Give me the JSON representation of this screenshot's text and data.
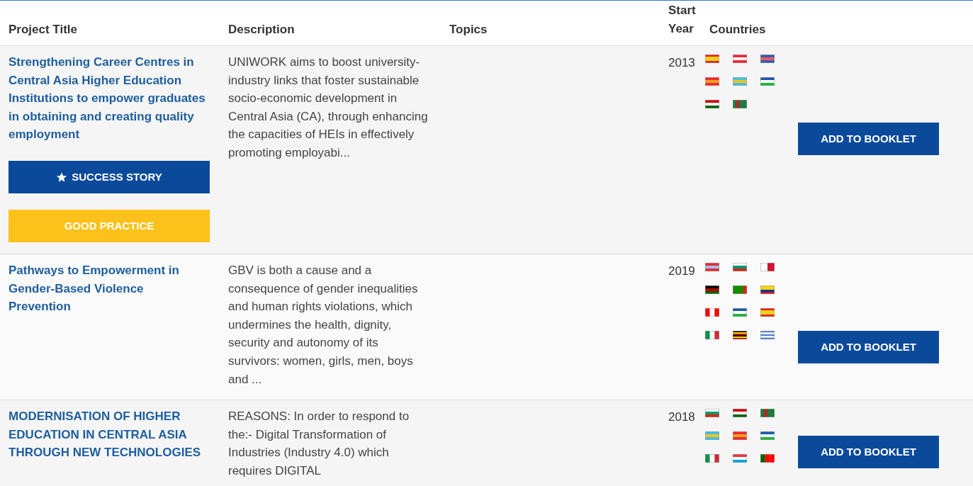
{
  "table": {
    "columns": [
      {
        "label": "Project Title"
      },
      {
        "label": "Description"
      },
      {
        "label": "Topics"
      },
      {
        "label": "Start Year"
      },
      {
        "label": "Countries"
      }
    ],
    "rows": [
      {
        "title": "Strengthening Career Centres in Central Asia Higher Education Institutions to empower graduates in obtaining and creating quality employment",
        "badges": [
          {
            "kind": "success",
            "label": "SUCCESS STORY"
          },
          {
            "kind": "practice",
            "label": "GOOD PRACTICE"
          }
        ],
        "description": "UNIWORK aims to boost university-industry links that foster sustainable socio-economic development in Central Asia (CA), through enhancing the capacities of HEIs in effectively promoting employabi...",
        "year": "2013",
        "flags": [
          {
            "kind": "es"
          },
          {
            "kind": "at"
          },
          {
            "kind": "gb"
          },
          {
            "kind": "kg"
          },
          {
            "kind": "kz"
          },
          {
            "kind": "uz"
          },
          {
            "kind": "tj"
          },
          {
            "kind": "tm"
          }
        ],
        "button": "ADD TO BOOKLET"
      },
      {
        "title": "Pathways to Empowerment in Gender-Based Violence Prevention",
        "badges": [],
        "description": "GBV is both a cause and a consequence of gender inequalities and human rights violations, which undermines the health, dignity, security and autonomy of its survivors: women, girls, men, boys and ...",
        "year": "2019",
        "flags": [
          {
            "kind": "no"
          },
          {
            "kind": "bg"
          },
          {
            "kind": "mt"
          },
          {
            "kind": "ke"
          },
          {
            "kind": "zm"
          },
          {
            "kind": "co"
          },
          {
            "kind": "ca"
          },
          {
            "kind": "uz"
          },
          {
            "kind": "es"
          },
          {
            "kind": "it"
          },
          {
            "kind": "ug"
          },
          {
            "kind": "gr"
          }
        ],
        "button": "ADD TO BOOKLET"
      },
      {
        "title": "MODERNISATION OF HIGHER EDUCATION IN CENTRAL ASIA THROUGH NEW TECHNOLOGIES",
        "badges": [],
        "description": "REASONS: In order to respond to the:- Digital Transformation of Industries (Industry 4.0) which requires DIGITAL",
        "year": "2018",
        "flags": [
          {
            "kind": "bg"
          },
          {
            "kind": "tj"
          },
          {
            "kind": "tm"
          },
          {
            "kind": "kz"
          },
          {
            "kind": "kg"
          },
          {
            "kind": "uz"
          },
          {
            "kind": "it"
          },
          {
            "kind": "lu"
          },
          {
            "kind": "pt"
          }
        ],
        "button": "ADD TO BOOKLET"
      }
    ]
  }
}
